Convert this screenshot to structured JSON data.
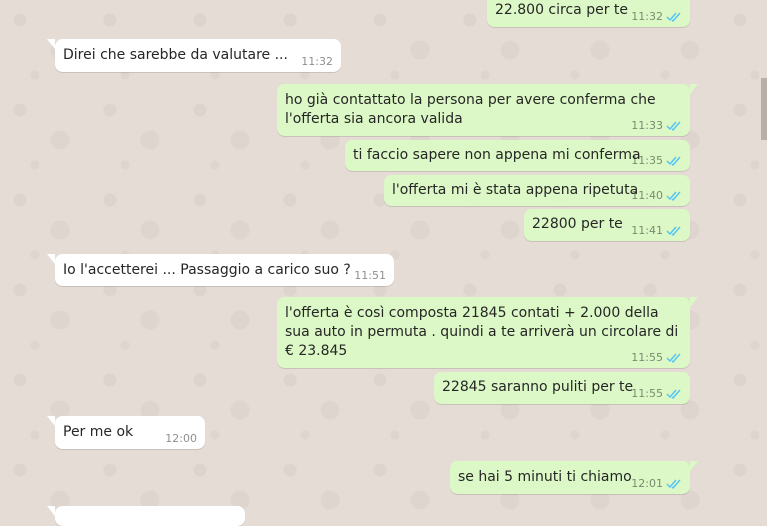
{
  "conversation": {
    "messages": [
      {
        "id": "m1",
        "direction": "out",
        "text": "22.800 circa per te",
        "time": "11:32",
        "read": true
      },
      {
        "id": "m2",
        "direction": "in",
        "text": "Direi che sarebbe da valutare ...",
        "time": "11:32"
      },
      {
        "id": "m3",
        "direction": "out",
        "text": "ho già contattato la persona per avere conferma che l'offerta sia ancora valida",
        "time": "11:33",
        "read": true
      },
      {
        "id": "m4",
        "direction": "out",
        "text": "ti faccio sapere non appena mi conferma",
        "time": "11:35",
        "read": true
      },
      {
        "id": "m5",
        "direction": "out",
        "text": "l'offerta mi è stata appena ripetuta",
        "time": "11:40",
        "read": true
      },
      {
        "id": "m6",
        "direction": "out",
        "text": "22800 per te",
        "time": "11:41",
        "read": true
      },
      {
        "id": "m7",
        "direction": "in",
        "text": "Io l'accetterei ... Passaggio a carico suo ?",
        "time": "11:51"
      },
      {
        "id": "m8",
        "direction": "out",
        "text": "l'offerta è così composta 21845 contati + 2.000 della sua auto in permuta . quindi a te arriverà un circolare di € 23.845",
        "time": "11:55",
        "read": true
      },
      {
        "id": "m9",
        "direction": "out",
        "text": "22845 saranno puliti per te",
        "time": "11:55",
        "read": true
      },
      {
        "id": "m10",
        "direction": "in",
        "text": "Per me ok",
        "time": "12:00"
      },
      {
        "id": "m11",
        "direction": "out",
        "text": "se hai 5 minuti ti chiamo",
        "time": "12:01",
        "read": true
      }
    ]
  },
  "colors": {
    "background": "#e5ddd5",
    "incoming_bubble": "#ffffff",
    "outgoing_bubble": "#dcf8c6",
    "read_ticks": "#4fc3f7"
  }
}
